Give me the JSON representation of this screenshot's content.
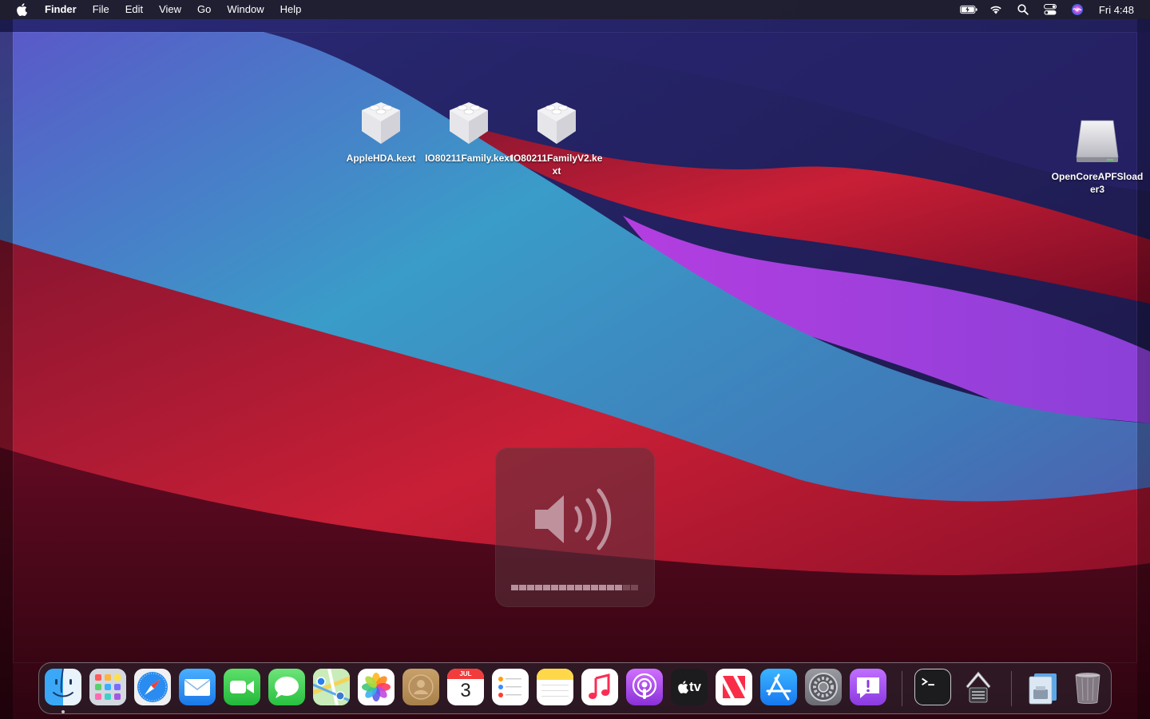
{
  "menubar": {
    "apple_icon": "apple-logo-icon",
    "app_name": "Finder",
    "menus": [
      "File",
      "Edit",
      "View",
      "Go",
      "Window",
      "Help"
    ],
    "status_icons": [
      "battery-charging-icon",
      "wifi-icon",
      "spotlight-search-icon",
      "control-center-icon",
      "siri-icon"
    ],
    "clock": "Fri 4:48"
  },
  "desktop": {
    "icons": [
      {
        "label": "AppleHDA.kext",
        "icon": "kext-bundle-icon"
      },
      {
        "label": "IO80211Family.kext",
        "icon": "kext-bundle-icon"
      },
      {
        "label": "IO80211FamilyV2.kext",
        "icon": "kext-bundle-icon"
      },
      {
        "label": "OpenCoreAPFSloader3",
        "icon": "external-drive-icon"
      }
    ]
  },
  "volume_hud": {
    "icon": "speaker-volume-icon",
    "level": 0.875,
    "segments_total": 16,
    "segments_filled": 14
  },
  "dock": {
    "apps": [
      {
        "name": "Finder",
        "icon": "finder-icon",
        "running": true
      },
      {
        "name": "Launchpad",
        "icon": "launchpad-icon"
      },
      {
        "name": "Safari",
        "icon": "safari-icon"
      },
      {
        "name": "Mail",
        "icon": "mail-icon"
      },
      {
        "name": "FaceTime",
        "icon": "facetime-icon"
      },
      {
        "name": "Messages",
        "icon": "messages-icon"
      },
      {
        "name": "Maps",
        "icon": "maps-icon"
      },
      {
        "name": "Photos",
        "icon": "photos-icon"
      },
      {
        "name": "Contacts",
        "icon": "contacts-icon"
      },
      {
        "name": "Calendar",
        "icon": "calendar-icon"
      },
      {
        "name": "Reminders",
        "icon": "reminders-icon"
      },
      {
        "name": "Notes",
        "icon": "notes-icon"
      },
      {
        "name": "Music",
        "icon": "music-icon"
      },
      {
        "name": "Podcasts",
        "icon": "podcasts-icon"
      },
      {
        "name": "TV",
        "icon": "apple-tv-icon"
      },
      {
        "name": "News",
        "icon": "news-icon"
      },
      {
        "name": "App Store",
        "icon": "app-store-icon"
      },
      {
        "name": "System Preferences",
        "icon": "system-preferences-icon"
      },
      {
        "name": "Feedback Assistant",
        "icon": "feedback-assistant-icon"
      },
      {
        "name": "Terminal",
        "icon": "terminal-icon"
      },
      {
        "name": "System Information",
        "icon": "system-information-icon"
      },
      {
        "name": "Downloads",
        "icon": "downloads-stack-icon"
      },
      {
        "name": "Trash",
        "icon": "trash-icon"
      }
    ],
    "calendar": {
      "month": "JUL",
      "day": "3"
    },
    "tv_label": "tv"
  },
  "colors": {
    "menubar_bg": "#201e2c",
    "wall_navy": "#1c1746",
    "wall_blue": "#3a9bc4",
    "wall_red": "#c8203a",
    "wall_purple": "#a040e0"
  }
}
